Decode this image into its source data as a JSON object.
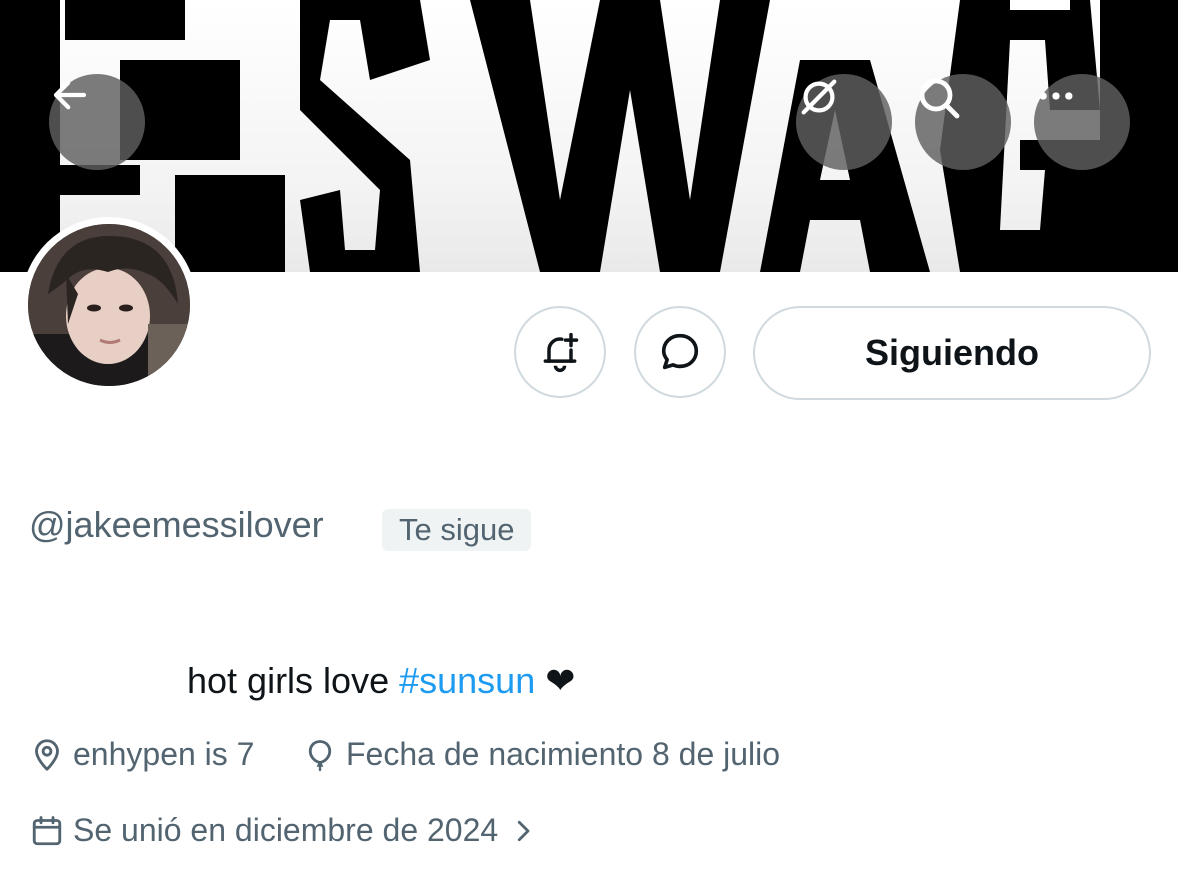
{
  "header": {
    "banner_text": "#SWAG",
    "back_icon": "arrow-left-icon",
    "grok_icon": "grok-icon",
    "search_icon": "search-icon",
    "more_icon": "more-horizontal-icon"
  },
  "profile": {
    "handle": "@jakeemessilover",
    "follows_you_badge": "Te sigue",
    "bio_text": "hot girls love ",
    "bio_hashtag": "#sunsun",
    "bio_emoji": " ❤",
    "location": "enhypen is 7",
    "birthday": "Fecha de nacimiento 8 de julio",
    "joined": "Se unió en diciembre de 2024"
  },
  "actions": {
    "notify_icon": "bell-plus-icon",
    "message_icon": "message-bubble-icon",
    "following_label": "Siguiendo"
  },
  "colors": {
    "link": "#1d9bf0",
    "secondary_text": "#536471",
    "border": "#cfd9de",
    "primary_text": "#0f1419"
  }
}
